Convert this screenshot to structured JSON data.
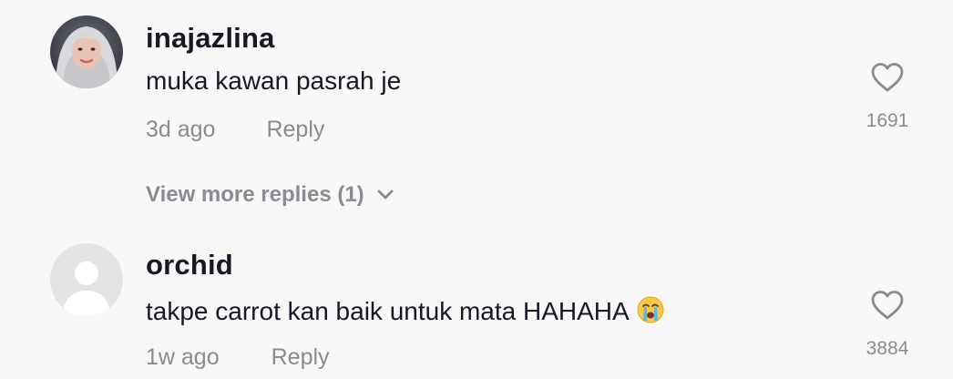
{
  "comments": [
    {
      "username": "inajazlina",
      "text": "muka kawan pasrah je",
      "time": "3d ago",
      "reply_label": "Reply",
      "likes": "1691",
      "avatar": "user-photo-avatar"
    },
    {
      "username": "orchid",
      "text": "takpe carrot kan baik untuk mata HAHAHA",
      "emoji": "loudly-crying-face-icon",
      "time": "1w ago",
      "reply_label": "Reply",
      "likes": "3884",
      "avatar": "default-avatar"
    }
  ],
  "view_more_replies": "View more replies (1)",
  "colors": {
    "background": "#f8f8f8",
    "primary_text": "#161823",
    "secondary_text": "#8a8b91"
  }
}
